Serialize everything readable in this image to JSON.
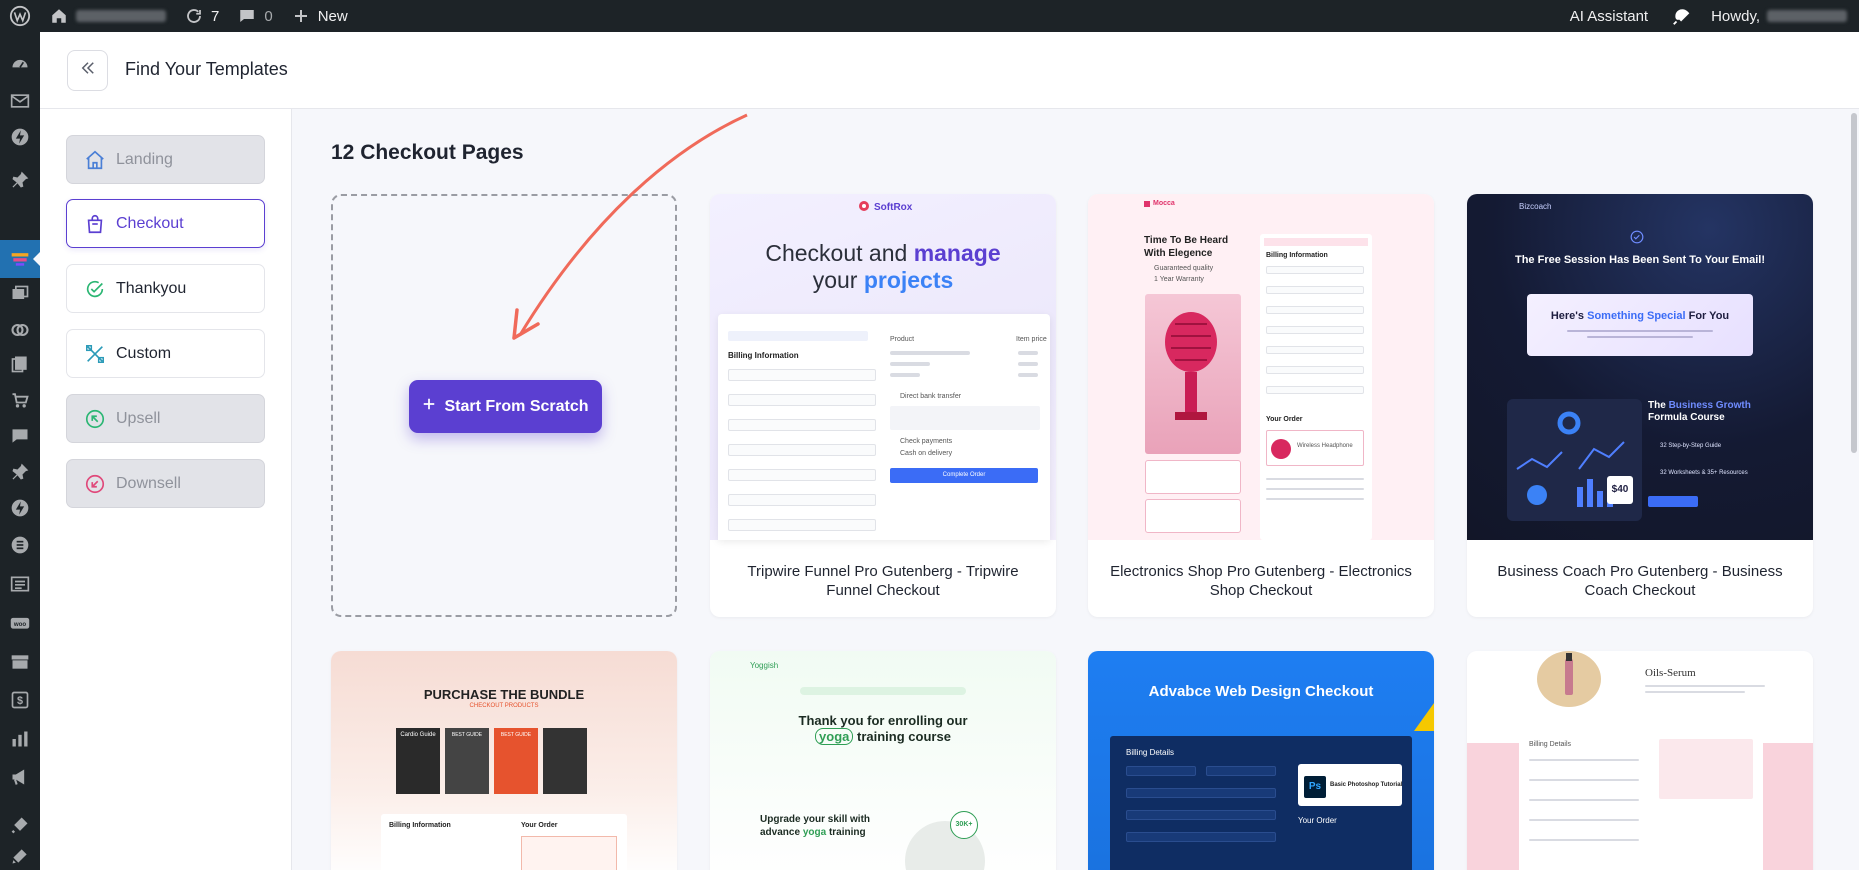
{
  "admin_bar": {
    "updates_count": "7",
    "comments_count": "0",
    "new_label": "New",
    "ai_assistant": "AI Assistant",
    "howdy": "Howdy,"
  },
  "header": {
    "title": "Find Your Templates"
  },
  "sidebar": {
    "items": [
      {
        "label": "Landing",
        "icon": "home-icon",
        "state": "disabled"
      },
      {
        "label": "Checkout",
        "icon": "bag-icon",
        "state": "active"
      },
      {
        "label": "Thankyou",
        "icon": "check-circle-icon",
        "state": "normal"
      },
      {
        "label": "Custom",
        "icon": "tools-icon",
        "state": "normal"
      },
      {
        "label": "Upsell",
        "icon": "arrow-up-left-circle-icon",
        "state": "disabled"
      },
      {
        "label": "Downsell",
        "icon": "arrow-down-left-circle-icon",
        "state": "disabled"
      }
    ]
  },
  "main": {
    "title": "12 Checkout Pages",
    "scratch_button": "Start From Scratch",
    "templates": [
      {
        "caption": "Tripwire Funnel Pro Gutenberg - Tripwire Funnel Checkout",
        "brand": "SoftRox",
        "headline_a": "Checkout and",
        "headline_b": "manage",
        "headline_c": "your",
        "headline_d": "projects",
        "form_title": "Billing Information",
        "col_product": "Product",
        "col_price": "Item price",
        "bank_transfer": "Direct bank transfer",
        "check_payments": "Check payments",
        "cash_delivery": "Cash on delivery",
        "button": "Complete Order"
      },
      {
        "caption": "Electronics Shop Pro Gutenberg - Electronics Shop Checkout",
        "brand": "Mocca",
        "headline": "Time To Be Heard With Elegence",
        "bullet_1": "Guaranteed quality",
        "bullet_2": "1 Year Warranty",
        "form_title": "Billing Information",
        "order_title": "Your Order",
        "product": "Wireless Headphone"
      },
      {
        "caption": "Business Coach Pro Gutenberg - Business Coach Checkout",
        "brand": "Bizcoach",
        "headline": "The Free Session Has Been Sent To Your Email!",
        "box_a": "Here's",
        "box_b": "Something Special",
        "box_c": "For You",
        "course_a": "The",
        "course_b": "Business Growth",
        "course_c": "Formula Course",
        "price": "$40",
        "bullet_1": "32 Step-by-Step Guide",
        "bullet_2": "32 Worksheets & 35+ Resources"
      },
      {
        "headline": "PURCHASE THE BUNDLE",
        "sub": "CHECKOUT PRODUCTS",
        "book_1": "Cardio Guide",
        "book_2": "BEST GUIDE",
        "book_3": "BEST GUIDE",
        "billing": "Billing Information",
        "order": "Your Order"
      },
      {
        "brand": "Yoggish",
        "headline_a": "Thank you for enrolling our",
        "headline_b": "yoga",
        "headline_c": "training course",
        "sub_a": "Upgrade your skill with",
        "sub_b": "advance",
        "sub_c": "yoga",
        "sub_d": "training",
        "badge": "30K+"
      },
      {
        "headline": "Advabce Web Design Checkout",
        "billing": "Billing Details",
        "product": "Basic Photoshop Tutorial",
        "order": "Your Order"
      },
      {
        "brand": "Oils-Serum",
        "billing": "Billing Details"
      }
    ]
  }
}
